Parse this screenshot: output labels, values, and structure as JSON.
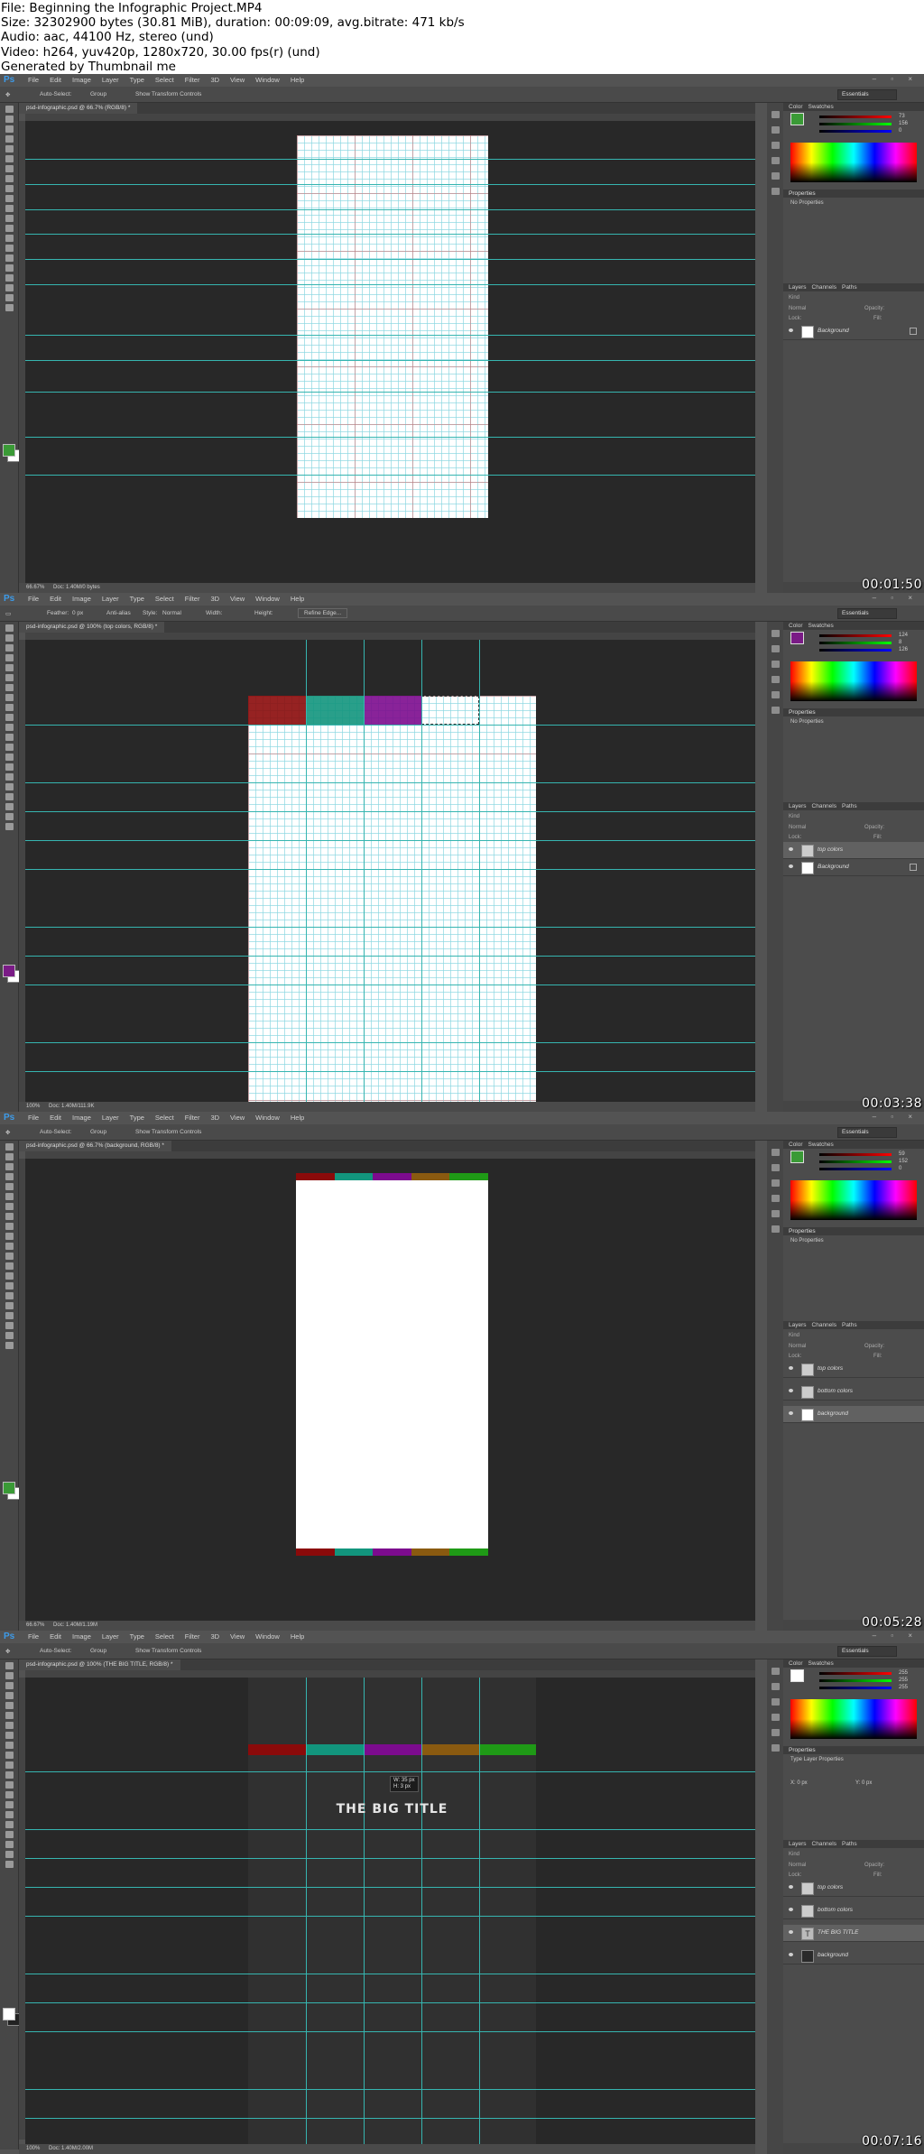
{
  "header": {
    "lines": [
      "File: Beginning the Infographic Project.MP4",
      "Size: 32302900 bytes (30.81 MiB), duration: 00:09:09, avg.bitrate: 471 kb/s",
      "Audio: aac, 44100 Hz, stereo (und)",
      "Video: h264, yuv420p, 1280x720, 30.00 fps(r) (und)",
      "Generated by Thumbnail me"
    ]
  },
  "app": {
    "logo": "Ps",
    "menu": [
      "File",
      "Edit",
      "Image",
      "Layer",
      "Type",
      "Select",
      "Filter",
      "3D",
      "View",
      "Window",
      "Help"
    ],
    "window_controls": "– ▫ ×",
    "workspace": "Essentials",
    "color_tab": "Color",
    "swatches_tab": "Swatches",
    "properties_title": "Properties",
    "layers_tab": "Layers",
    "channels_tab": "Channels",
    "paths_tab": "Paths",
    "kind": "Kind",
    "normal": "Normal",
    "opacity": "Opacity:",
    "fill": "Fill:",
    "lock": "Lock:"
  },
  "frames": [
    {
      "timestamp": "00:01:50",
      "doc_tab": "psd-infographic.psd @ 66.7% (RGB/8) *",
      "options": {
        "a": "Auto-Select:",
        "b": "Group",
        "c": "Show Transform Controls"
      },
      "status_zoom": "66.67%",
      "status_doc": "Doc: 1.40M/0 bytes",
      "properties_text": "No Properties",
      "fg_color": "#3a9a36",
      "color_values": [
        "73",
        "156",
        "0"
      ],
      "layers": [
        {
          "name": "Background",
          "selected": false,
          "thumb": "white",
          "lock": true
        }
      ]
    },
    {
      "timestamp": "00:03:38",
      "doc_tab": "psd-infographic.psd @ 100% (top colors, RGB/8) *",
      "options": {
        "a": "Feather:",
        "b": "0 px",
        "c": "Anti-alias",
        "d": "Style:",
        "e": "Normal",
        "f": "Width:",
        "g": "Height:",
        "h": "Refine Edge..."
      },
      "status_zoom": "100%",
      "status_doc": "Doc: 1.40M/111.9K",
      "properties_text": "No Properties",
      "fg_color": "#7a1b86",
      "color_values": [
        "124",
        "8",
        "126"
      ],
      "layers": [
        {
          "name": "top colors",
          "selected": true,
          "thumb": "trans",
          "lock": false
        },
        {
          "name": "Background",
          "selected": false,
          "thumb": "white",
          "lock": true
        }
      ]
    },
    {
      "timestamp": "00:05:28",
      "doc_tab": "psd-infographic.psd @ 66.7% (background, RGB/8) *",
      "options": {
        "a": "Auto-Select:",
        "b": "Group",
        "c": "Show Transform Controls"
      },
      "status_zoom": "66.67%",
      "status_doc": "Doc: 1.40M/1.19M",
      "properties_text": "No Properties",
      "fg_color": "#3a9a36",
      "color_values": [
        "59",
        "152",
        "0"
      ],
      "layers": [
        {
          "name": "top colors",
          "selected": false,
          "thumb": "trans",
          "lock": false
        },
        {
          "name": "bottom colors",
          "selected": false,
          "thumb": "trans",
          "lock": false
        },
        {
          "name": "background",
          "selected": true,
          "thumb": "white",
          "lock": false
        }
      ]
    },
    {
      "timestamp": "00:07:16",
      "doc_tab": "psd-infographic.psd @ 100% (THE BIG TITLE, RGB/8) *",
      "options": {
        "a": "Auto-Select:",
        "b": "Group",
        "c": "Show Transform Controls"
      },
      "status_zoom": "100%",
      "status_doc": "Doc: 1.40M/2.00M",
      "properties_text": "Type Layer Properties",
      "prop_x": "X: 0 px",
      "prop_y": "Y: 0 px",
      "canvas_title": "THE BIG TITLE",
      "tooltip_w": "W: 35 px",
      "tooltip_h": "H: 3 px",
      "fg_color": "#ffffff",
      "color_values": [
        "255",
        "255",
        "255"
      ],
      "layers": [
        {
          "name": "top colors",
          "selected": false,
          "thumb": "trans",
          "lock": false
        },
        {
          "name": "bottom colors",
          "selected": false,
          "thumb": "trans",
          "lock": false
        },
        {
          "name": "THE BIG TITLE",
          "selected": true,
          "thumb": "type",
          "lock": false
        },
        {
          "name": "background",
          "selected": false,
          "thumb": "dark",
          "lock": false
        }
      ]
    }
  ],
  "stripe_colors": {
    "red": "#8b0a0a",
    "teal": "#12957d",
    "purple": "#7c0b8e",
    "orange": "#8a5a10",
    "green": "#1f9a16"
  }
}
